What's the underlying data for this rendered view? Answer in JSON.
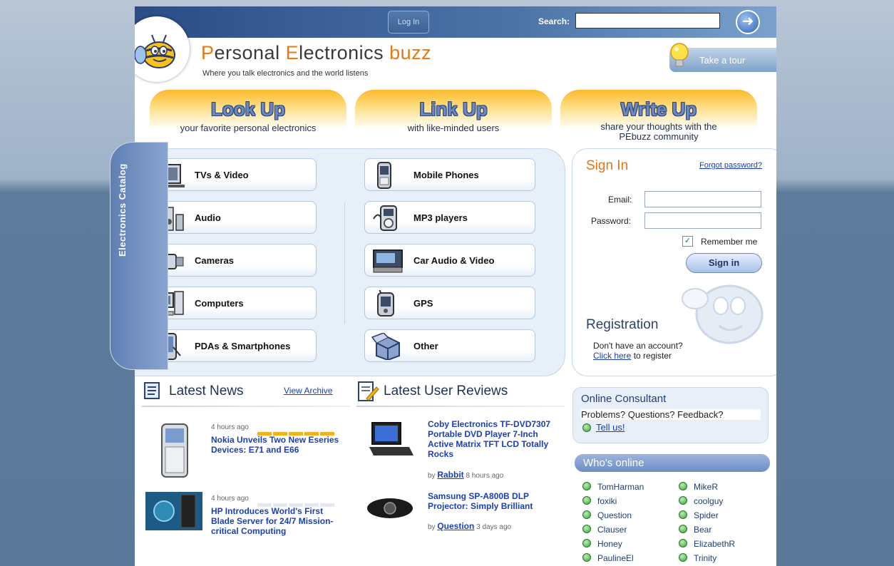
{
  "header": {
    "login_label": "Log In",
    "search_label": "Search:",
    "search_value": "",
    "site_title_parts": [
      "P",
      "ersonal ",
      "E",
      "lectronics ",
      "buzz"
    ],
    "tagline": "Where you talk electronics and the world listens",
    "tour_label": "Take a tour"
  },
  "hero": [
    {
      "title": "Look Up",
      "sub": "your favorite personal electronics"
    },
    {
      "title": "Link Up",
      "sub": "with like-minded users"
    },
    {
      "title": "Write Up",
      "sub": "share your thoughts with the PEbuzz community"
    }
  ],
  "catalog": {
    "label": "Electronics Catalog",
    "items": [
      {
        "label": "TVs & Video",
        "icon": "tv-icon"
      },
      {
        "label": "Mobile Phones",
        "icon": "mobile-phone-icon"
      },
      {
        "label": "Audio",
        "icon": "speakers-icon"
      },
      {
        "label": "MP3 players",
        "icon": "mp3-player-icon"
      },
      {
        "label": "Cameras",
        "icon": "camcorder-icon"
      },
      {
        "label": "Car Audio & Video",
        "icon": "car-stereo-icon"
      },
      {
        "label": "Computers",
        "icon": "desktop-computer-icon"
      },
      {
        "label": "GPS",
        "icon": "gps-device-icon"
      },
      {
        "label": "PDAs & Smartphones",
        "icon": "pda-icon"
      },
      {
        "label": "Other",
        "icon": "box-icon"
      }
    ]
  },
  "signin": {
    "title": "Sign In",
    "forgot": "Forgot password?",
    "email_label": "Email:",
    "password_label": "Password:",
    "email_value": "",
    "password_value": "",
    "remember_label": "Remember me",
    "remember_checked": true,
    "button": "Sign in",
    "registration_title": "Registration",
    "registration_text": "Don't have an account?",
    "registration_link": "Click here",
    "registration_suffix": " to register"
  },
  "news": {
    "title": "Latest News",
    "archive": "View Archive",
    "items": [
      {
        "time": "4 hours ago",
        "title": "Nokia Unveils Two New Eseries Devices: E71 and E66",
        "rating": 5
      },
      {
        "time": "4 hours ago",
        "title": "HP Introduces World's First Blade Server for 24/7 Mission-critical Computing",
        "rating": 0
      }
    ]
  },
  "reviews": {
    "title": "Latest User Reviews",
    "items": [
      {
        "title": "Coby Electronics TF-DVD7307 Portable DVD Player 7-Inch Active Matrix TFT LCD Totally Rocks",
        "by": "by",
        "user": "Rabbit",
        "time": "8 hours ago"
      },
      {
        "title": "Samsung SP-A800B DLP Projector: Simply Brilliant",
        "by": "by",
        "user": "Question",
        "time": "3 days ago"
      }
    ]
  },
  "consultant": {
    "title": "Online Consultant",
    "question": "Problems? Questions? Feedback?",
    "link": "Tell us!"
  },
  "whos_online": {
    "title": "Who's online",
    "users_left": [
      "TomHarman",
      "foxiki",
      "Question",
      "Clauser",
      "Honey",
      "PaulineEl"
    ],
    "users_right": [
      "MikeR",
      "coolguy",
      "Spider",
      "Bear",
      "ElizabethR",
      "Trinity"
    ]
  },
  "colors": {
    "accent_orange": "#e8780f",
    "link_blue": "#1a3fb6",
    "online_green": "#3fa142"
  }
}
